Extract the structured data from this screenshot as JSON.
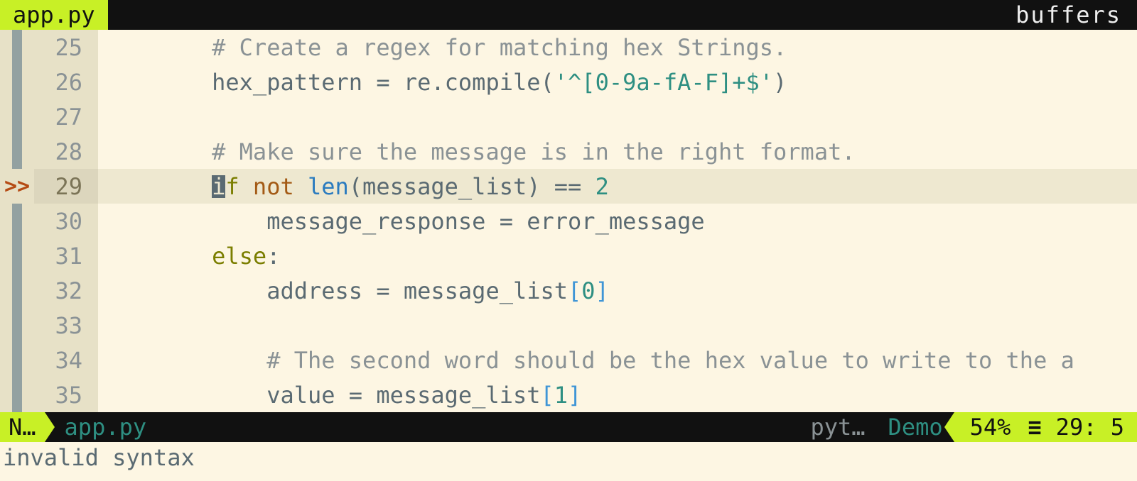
{
  "tabline": {
    "active_tab": "app.py",
    "right_label": "buffers"
  },
  "editor": {
    "cursor": {
      "line": 29,
      "col": 5
    },
    "lines": [
      {
        "num": 25,
        "sign": "bar",
        "tokens": [
          {
            "t": "        ",
            "c": ""
          },
          {
            "t": "# Create a regex for matching hex Strings.",
            "c": "c-comm"
          }
        ]
      },
      {
        "num": 26,
        "sign": "bar",
        "tokens": [
          {
            "t": "        hex_pattern = re.compile(",
            "c": ""
          },
          {
            "t": "'^[0-9a-fA-F]+$'",
            "c": "c-str"
          },
          {
            "t": ")",
            "c": ""
          }
        ]
      },
      {
        "num": 27,
        "sign": "bar",
        "tokens": []
      },
      {
        "num": 28,
        "sign": "bar",
        "tokens": [
          {
            "t": "        ",
            "c": ""
          },
          {
            "t": "# Make sure the message is in the right format.",
            "c": "c-comm"
          }
        ]
      },
      {
        "num": 29,
        "sign": "err",
        "current": true,
        "tokens": [
          {
            "t": "        ",
            "c": ""
          },
          {
            "t": "i",
            "c": "cursor-block"
          },
          {
            "t": "f",
            "c": "c-kw"
          },
          {
            "t": " ",
            "c": ""
          },
          {
            "t": "not",
            "c": "c-not"
          },
          {
            "t": " ",
            "c": ""
          },
          {
            "t": "len",
            "c": "c-fn"
          },
          {
            "t": "(message_list) == ",
            "c": ""
          },
          {
            "t": "2",
            "c": "c-num"
          },
          {
            "t": "_",
            "c": "trail-cursor"
          }
        ]
      },
      {
        "num": 30,
        "sign": "bar",
        "tokens": [
          {
            "t": "            message_response = error_message",
            "c": ""
          }
        ]
      },
      {
        "num": 31,
        "sign": "bar",
        "tokens": [
          {
            "t": "        ",
            "c": ""
          },
          {
            "t": "else",
            "c": "c-kw"
          },
          {
            "t": ":",
            "c": ""
          }
        ]
      },
      {
        "num": 32,
        "sign": "bar",
        "tokens": [
          {
            "t": "            address = message_list",
            "c": ""
          },
          {
            "t": "[",
            "c": "c-bracket"
          },
          {
            "t": "0",
            "c": "c-num"
          },
          {
            "t": "]",
            "c": "c-bracket"
          }
        ]
      },
      {
        "num": 33,
        "sign": "bar",
        "tokens": []
      },
      {
        "num": 34,
        "sign": "bar",
        "tokens": [
          {
            "t": "            ",
            "c": ""
          },
          {
            "t": "# The second word should be the hex value to write to the a",
            "c": "c-comm"
          }
        ]
      },
      {
        "num": 35,
        "sign": "bar",
        "tokens": [
          {
            "t": "            value = message_list",
            "c": ""
          },
          {
            "t": "[",
            "c": "c-bracket"
          },
          {
            "t": "1",
            "c": "c-num"
          },
          {
            "t": "]",
            "c": "c-bracket"
          }
        ]
      }
    ]
  },
  "statusline": {
    "mode": "N…",
    "filename": "app.py",
    "filetype": "pyt…",
    "section": "Demo",
    "percent": "54%",
    "hamburger": "≡",
    "row_col": "29:   5"
  },
  "cmdline": {
    "message": "invalid syntax"
  }
}
